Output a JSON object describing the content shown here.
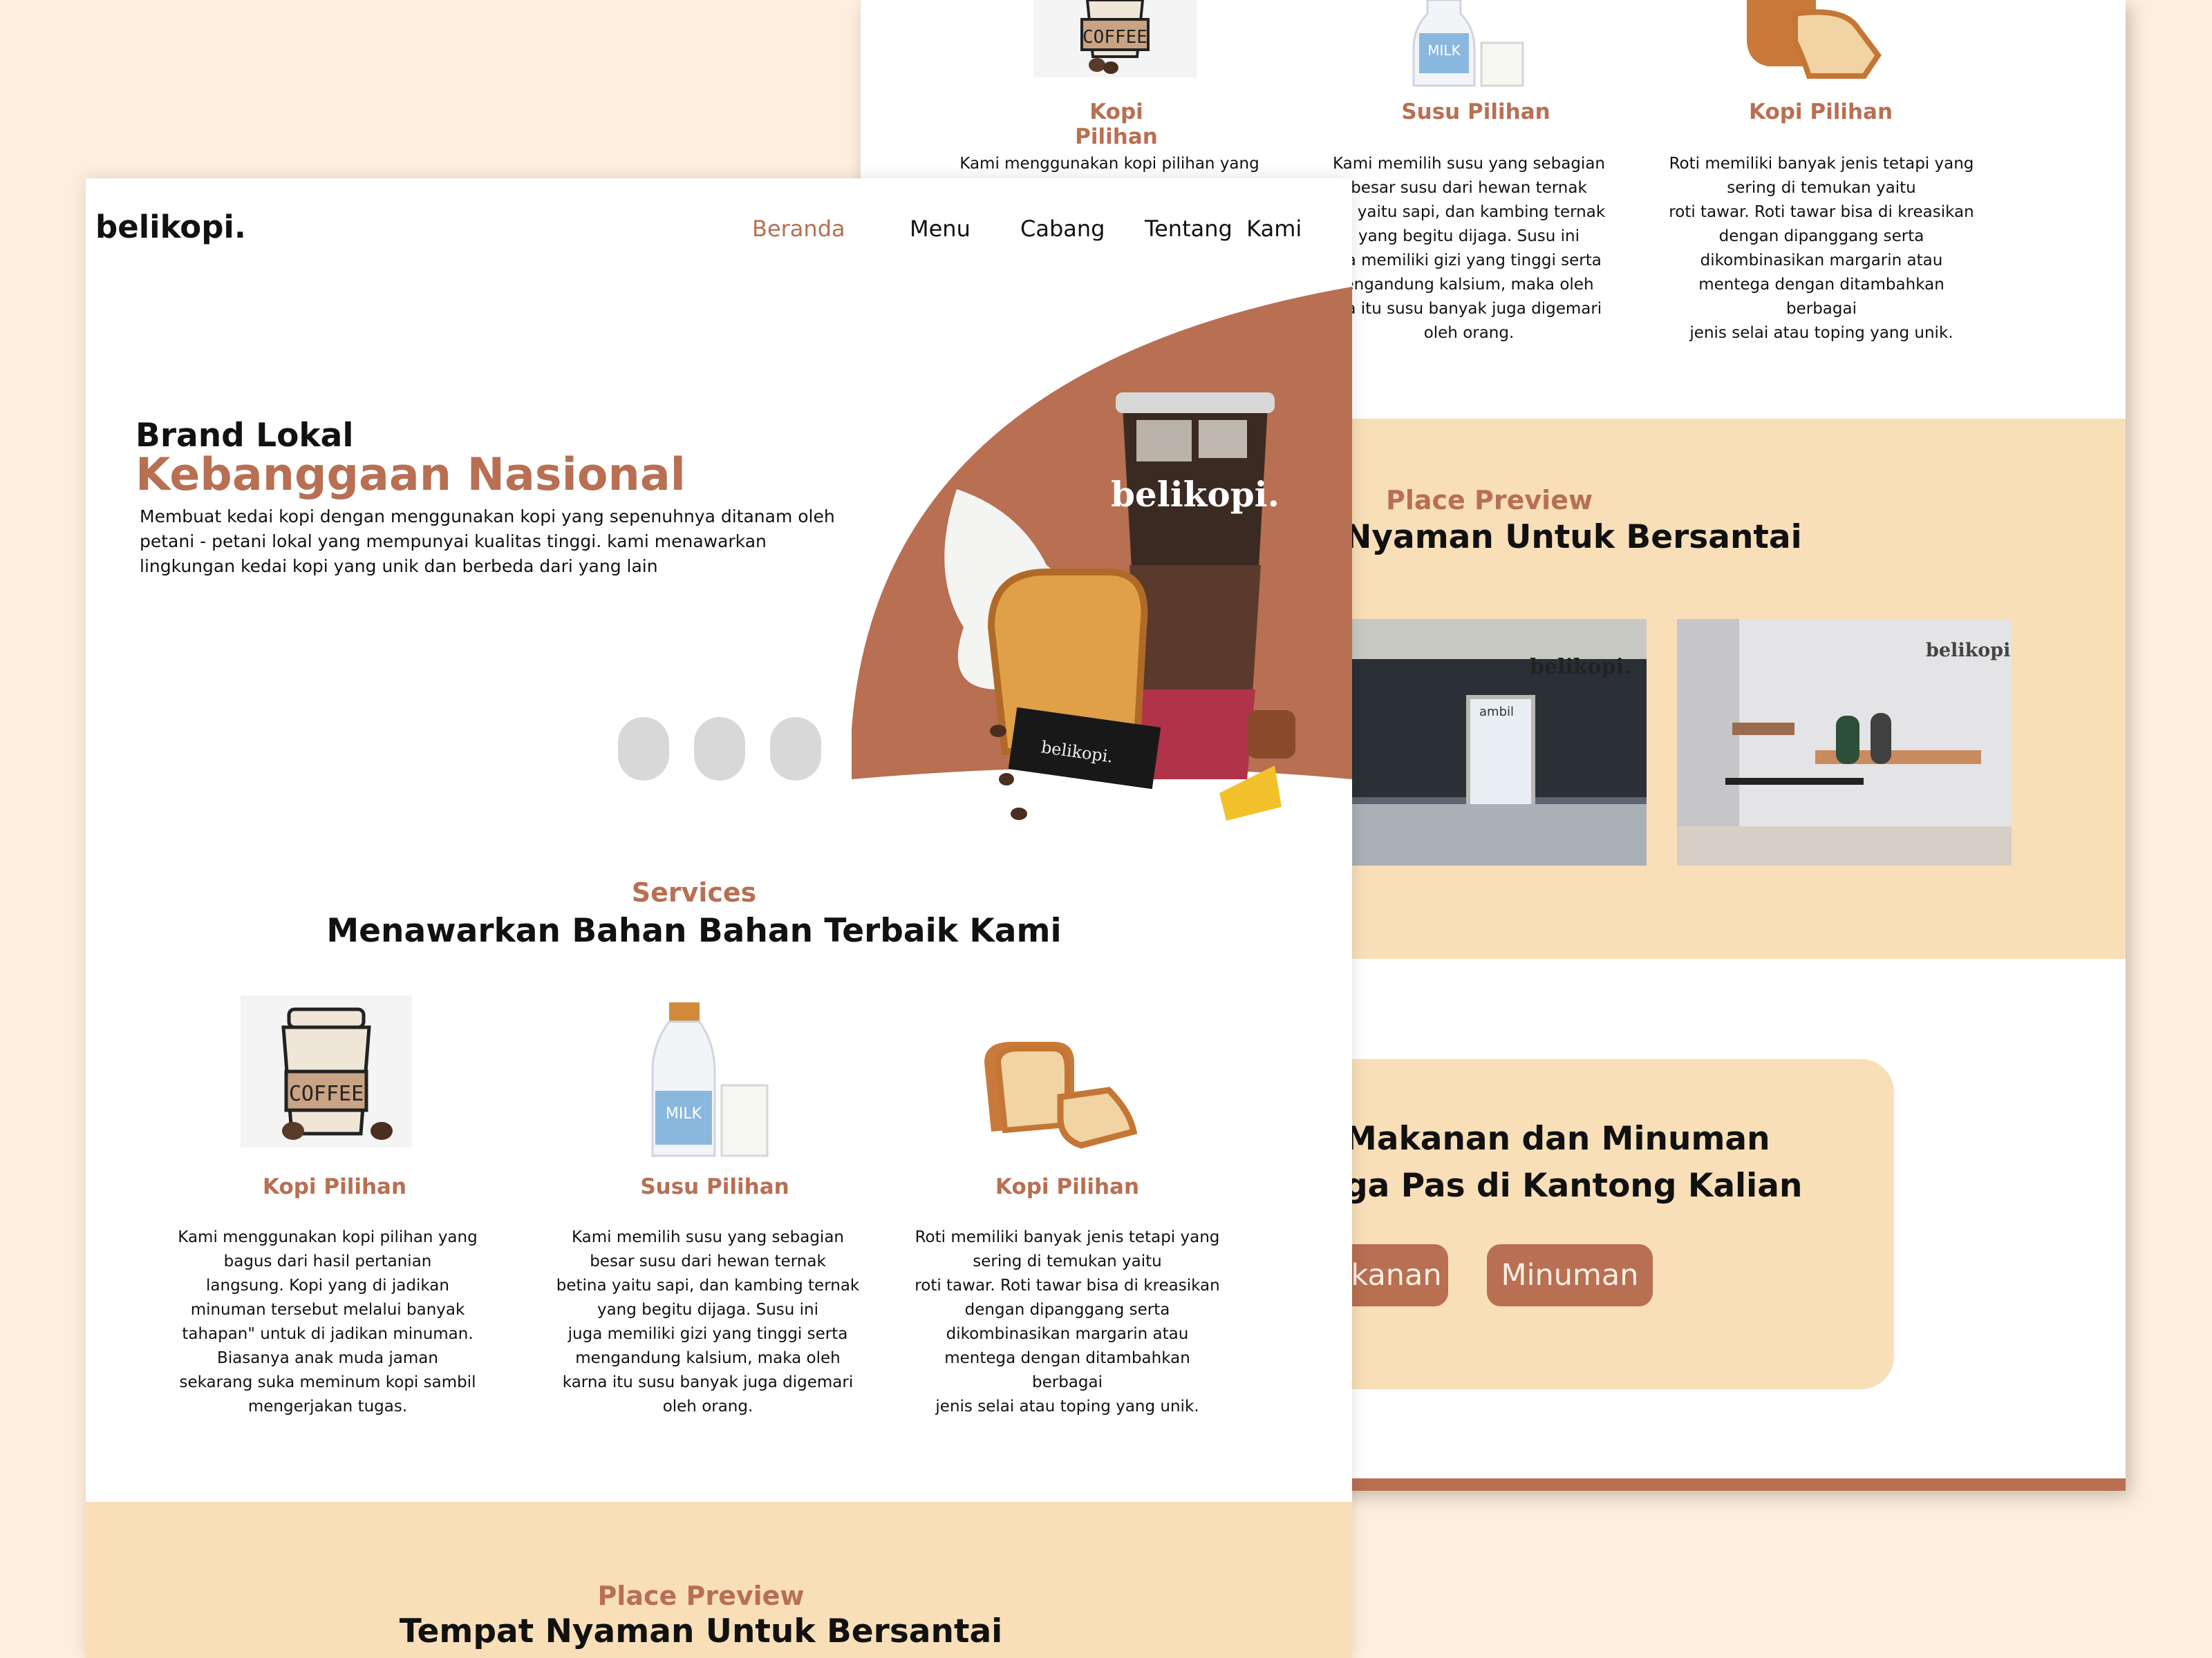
{
  "brand": {
    "logo": "belikopi."
  },
  "nav": [
    {
      "label": "Beranda",
      "active": true
    },
    {
      "label": "Menu",
      "active": false
    },
    {
      "label": "Cabang",
      "active": false
    },
    {
      "label": "Tentang  Kami",
      "active": false
    }
  ],
  "hero": {
    "subtitle": "Brand Lokal",
    "title": "Kebanggaan Nasional",
    "description_lines": [
      "Membuat kedai kopi dengan menggunakan kopi yang sepenuhnya ditanam oleh",
      "petani - petani lokal yang mempunyai kualitas tinggi. kami menawarkan",
      "lingkungan kedai kopi yang unik dan berbeda dari yang lain"
    ],
    "image_brand_text": "belikopi.",
    "box_text": "belikopi."
  },
  "services": {
    "eyebrow": "Services",
    "title": "Menawarkan Bahan Bahan Terbaik Kami",
    "items": [
      {
        "title": "Kopi Pilihan",
        "icon": "coffee-cup-icon",
        "icon_text": "COFFEE",
        "lines": [
          "Kami menggunakan kopi pilihan yang",
          "bagus dari hasil pertanian",
          "langsung. Kopi yang di jadikan",
          "minuman tersebut melalui banyak",
          "tahapan\" untuk di jadikan minuman.",
          "Biasanya anak muda jaman",
          "sekarang suka meminum kopi sambil",
          "mengerjakan tugas."
        ]
      },
      {
        "title": "Susu Pilihan",
        "icon": "milk-bottle-icon",
        "icon_text": "MILK",
        "lines": [
          "Kami memilih susu yang sebagian",
          "besar susu dari hewan ternak",
          "betina yaitu sapi, dan kambing ternak",
          "yang begitu dijaga. Susu ini",
          "juga memiliki gizi yang tinggi serta",
          "mengandung kalsium, maka oleh",
          "karna itu susu banyak juga digemari",
          "oleh orang."
        ]
      },
      {
        "title": "Kopi Pilihan",
        "icon": "bread-icon",
        "icon_text": "",
        "lines": [
          "Roti memiliki banyak jenis tetapi yang",
          "sering di temukan yaitu",
          "roti tawar. Roti tawar bisa di kreasikan",
          "dengan dipanggang serta",
          "dikombinasikan margarin atau",
          "mentega dengan ditambahkan",
          "berbagai",
          "jenis selai atau toping yang unik."
        ]
      }
    ]
  },
  "back_services": {
    "items": [
      {
        "title": "Kopi Pilihan",
        "lines": [
          "Kami menggunakan kopi pilihan yang"
        ]
      },
      {
        "title": "Susu Pilihan",
        "lines": [
          "Kami memilih susu yang sebagian",
          "besar susu dari hewan ternak",
          "na yaitu sapi, dan kambing ternak",
          "yang begitu dijaga. Susu ini",
          "ga memiliki gizi yang tinggi serta",
          "engandung kalsium, maka oleh",
          "na itu susu banyak juga digemari",
          "oleh orang."
        ]
      },
      {
        "title": "Kopi Pilihan",
        "lines": [
          "Roti memiliki banyak jenis tetapi yang",
          "sering di temukan yaitu",
          "roti tawar. Roti tawar bisa di kreasikan",
          "dengan dipanggang serta",
          "dikombinasikan margarin atau",
          "mentega dengan ditambahkan",
          "berbagai",
          "jenis selai atau toping yang unik."
        ]
      }
    ]
  },
  "place": {
    "eyebrow": "Place Preview",
    "title": "Tempat Nyaman Untuk Bersantai",
    "back_title": "Nyaman Untuk Bersantai",
    "photo1_sign": "belikopi.",
    "photo1_door": "ambil",
    "photo2_sign": "belikopi."
  },
  "menu_card": {
    "line1": "Makanan dan Minuman",
    "line2": "ga Pas di Kantong Kalian",
    "buttons": [
      "kanan",
      "Minuman"
    ]
  },
  "colors": {
    "accent": "#b86f52",
    "cream": "#f8dfb8",
    "background": "#fdeedd"
  }
}
